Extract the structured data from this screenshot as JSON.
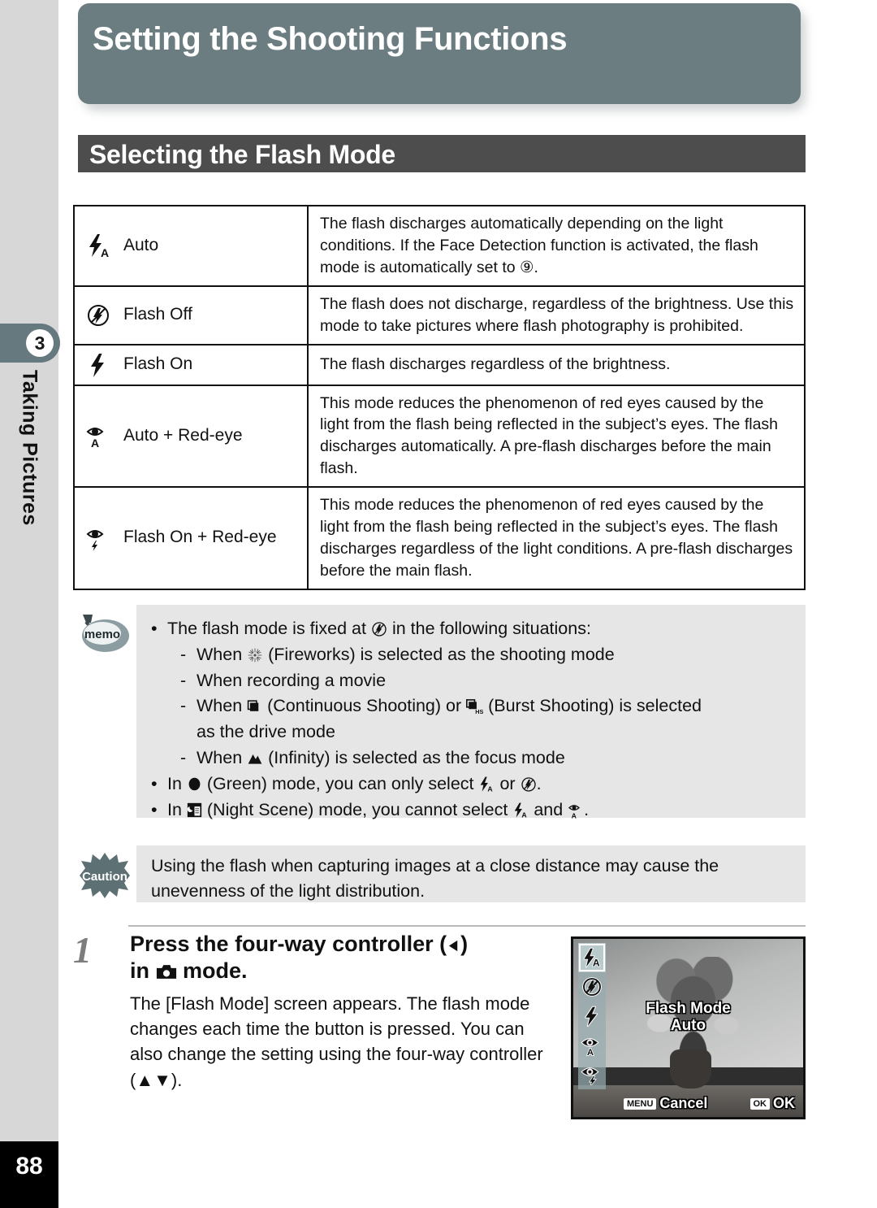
{
  "page": {
    "number": "88",
    "chapter_number": "3",
    "chapter_label": "Taking Pictures",
    "banner_title": "Setting the Shooting Functions",
    "section_title": "Selecting the Flash Mode"
  },
  "table": {
    "rows": [
      {
        "icon": "flash-auto-icon",
        "mode": "Auto",
        "description": "The flash discharges automatically depending on the light conditions. If the Face Detection function is activated, the flash mode is automatically set to ⑨."
      },
      {
        "icon": "flash-off-icon",
        "mode": "Flash Off",
        "description": "The flash does not discharge, regardless of the brightness. Use this mode to take pictures where flash photography is prohibited."
      },
      {
        "icon": "flash-on-icon",
        "mode": "Flash On",
        "description": "The flash discharges regardless of the brightness."
      },
      {
        "icon": "red-eye-auto-icon",
        "mode": "Auto + Red-eye",
        "description": "This mode reduces the phenomenon of red eyes caused by the light from the flash being reflected in the subject’s eyes. The flash discharges automatically. A pre-flash discharges before the main flash."
      },
      {
        "icon": "red-eye-flash-on-icon",
        "mode": "Flash On + Red-eye",
        "description": "This mode reduces the phenomenon of red eyes caused by the light from the flash being reflected in the subject’s eyes. The flash discharges regardless of the light conditions. A pre-flash discharges before the main flash."
      }
    ]
  },
  "memo": {
    "icon": "memo-icon",
    "lines": [
      {
        "level": 1,
        "bullet": "•",
        "pre": "The flash mode is fixed at ",
        "icon": "flash-off-icon",
        "post": " in the following situations:"
      },
      {
        "level": 2,
        "bullet": "-",
        "pre": "When ",
        "icon": "fireworks-icon",
        "post": " (Fireworks) is selected as the shooting mode"
      },
      {
        "level": 2,
        "bullet": "-",
        "pre": "When recording a movie",
        "icon": "",
        "post": ""
      },
      {
        "level": 2,
        "bullet": "-",
        "pre": "When ",
        "icon": "continuous-shooting-icon",
        "post": " (Continuous Shooting) or ",
        "icon2": "burst-shooting-icon",
        "post2": " (Burst Shooting) is selected"
      },
      {
        "level": 2,
        "bullet": "",
        "pre": "as the drive mode",
        "icon": "",
        "post": ""
      },
      {
        "level": 2,
        "bullet": "-",
        "pre": "When ",
        "icon": "infinity-focus-icon",
        "post": " (Infinity) is selected as the focus mode"
      },
      {
        "level": 1,
        "bullet": "•",
        "pre": "In ",
        "icon": "green-mode-icon",
        "post": " (Green) mode, you can only select ",
        "icon2": "flash-auto-icon",
        "post2": " or ",
        "icon3": "flash-off-icon",
        "post3": "."
      },
      {
        "level": 1,
        "bullet": "•",
        "pre": "In ",
        "icon": "night-scene-icon",
        "post": " (Night Scene) mode, you cannot select ",
        "icon2": "flash-auto-icon",
        "post2": " and ",
        "icon3": "red-eye-auto-icon",
        "post3": "."
      }
    ]
  },
  "caution": {
    "icon": "caution-icon",
    "label": "Caution",
    "text": "Using the flash when capturing images at a close distance may cause the unevenness of the light distribution."
  },
  "step": {
    "number": "1",
    "heading_line1_pre": "Press the four-way controller (",
    "heading_line1_icon": "arrow-left-icon",
    "heading_line1_post": ")",
    "heading_line2_pre": "in ",
    "heading_line2_icon": "camera-mode-icon",
    "heading_line2_post": " mode.",
    "body": "The [Flash Mode] screen appears. The flash mode changes each time the button is pressed. You can also change the setting using the four-way controller (▲▼)."
  },
  "camera_screen": {
    "title": "Flash Mode",
    "value": "Auto",
    "menu_chip": "MENU",
    "menu_label": "Cancel",
    "ok_chip": "OK",
    "ok_label": "OK",
    "strip_items": [
      {
        "icon": "flash-auto-icon",
        "selected": true
      },
      {
        "icon": "flash-off-icon",
        "selected": false
      },
      {
        "icon": "flash-on-icon",
        "selected": false
      },
      {
        "icon": "red-eye-auto-icon",
        "selected": false
      },
      {
        "icon": "red-eye-flash-on-icon",
        "selected": false
      }
    ]
  },
  "colors": {
    "banner": "#6c7d82",
    "section_bar": "#4d4d4d",
    "rail": "#d7d7d7",
    "note_box": "#e6e6e6",
    "page_box": "#000000"
  }
}
